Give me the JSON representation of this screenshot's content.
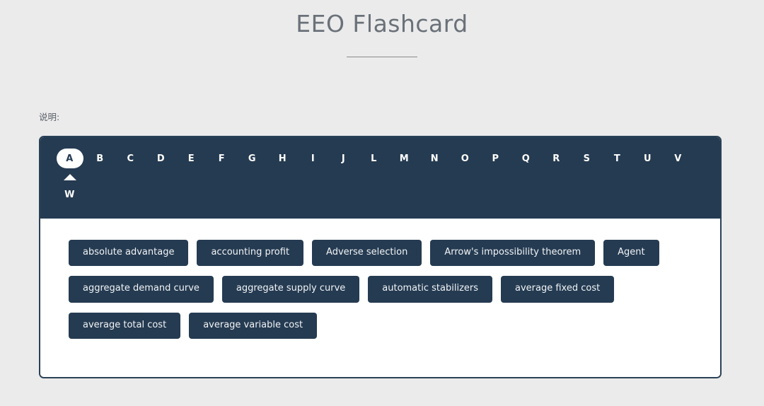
{
  "header": {
    "title": "EEO Flashcard",
    "divider": true
  },
  "instruction": {
    "label": "说明:"
  },
  "colors": {
    "page_background": "#ebebeb",
    "navy": "#253b52",
    "card_border": "#2a4156",
    "card_body": "#ffffff",
    "title_text": "#6a7179",
    "active_tab_background": "#ffffff",
    "active_tab_text": "#253b52"
  },
  "alphabet_nav": {
    "active_letter": "A",
    "indicator_icon": "caret-up-icon",
    "letters": [
      "A",
      "B",
      "C",
      "D",
      "E",
      "F",
      "G",
      "H",
      "I",
      "J",
      "L",
      "M",
      "N",
      "O",
      "P",
      "Q",
      "R",
      "S",
      "T",
      "U",
      "V",
      "W"
    ]
  },
  "terms": {
    "items": [
      "absolute advantage",
      "accounting profit",
      "Adverse selection",
      "Arrow's impossibility theorem",
      "Agent",
      "aggregate demand curve",
      "aggregate supply curve",
      "automatic stabilizers",
      "average fixed cost",
      "average total cost",
      "average variable cost"
    ]
  }
}
